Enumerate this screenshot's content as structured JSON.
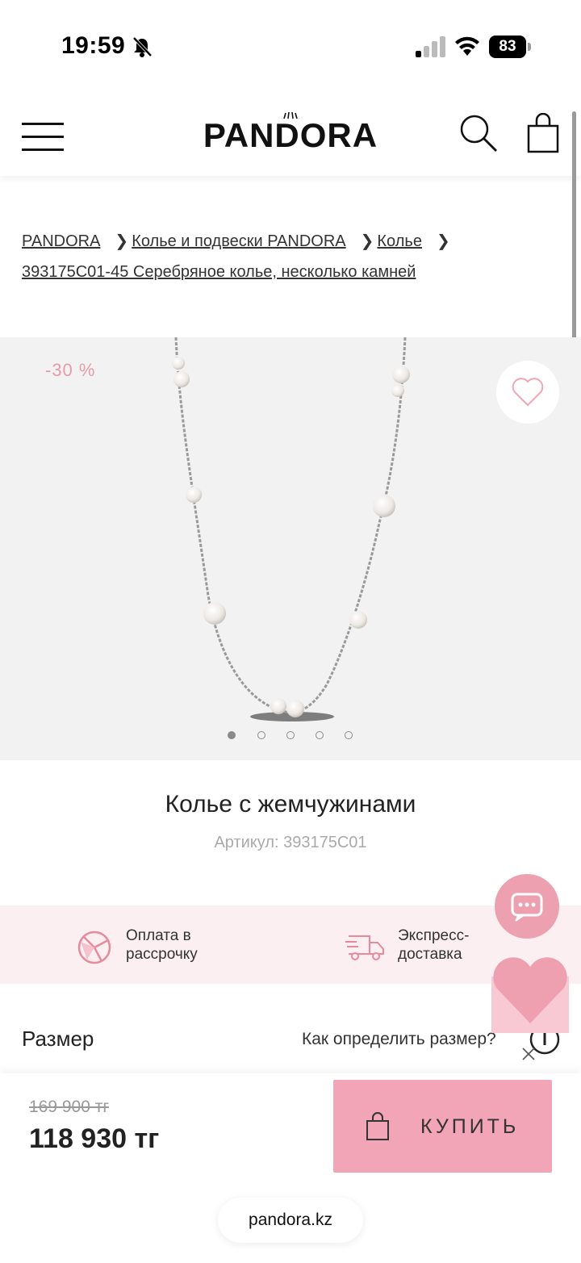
{
  "status_bar": {
    "time": "19:59",
    "battery": "83"
  },
  "header": {
    "logo": "PANDORA"
  },
  "breadcrumb": {
    "items": [
      "PANDORA",
      "Колье и подвески PANDORA",
      "Колье"
    ],
    "current": "393175C01-45 Серебряное колье, несколько камней"
  },
  "gallery": {
    "discount": "-30 %",
    "dots": 5,
    "active_dot": 0
  },
  "product": {
    "title": "Колье с жемчужинами",
    "sku": "Артикул: 393175C01"
  },
  "features": [
    {
      "line1": "Оплата в",
      "line2": "рассрочку",
      "icon": "installment-icon"
    },
    {
      "line1": "Экспресс-",
      "line2": "доставка",
      "icon": "delivery-truck-icon"
    }
  ],
  "size": {
    "label": "Размер",
    "help": "Как определить размер?"
  },
  "purchase": {
    "old_price": "169 900 тг",
    "price": "118 930 тг",
    "buy_label": "КУПИТЬ"
  },
  "browser": {
    "url": "pandora.kz"
  },
  "colors": {
    "accent_pink": "#f2a5b6",
    "band_pink": "#fbeff2",
    "discount_pink": "#e89aa8"
  }
}
